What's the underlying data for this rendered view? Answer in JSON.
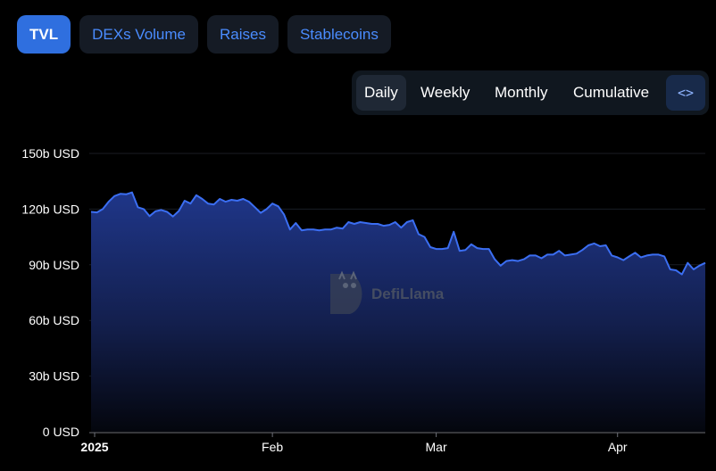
{
  "tabs": [
    "TVL",
    "DEXs Volume",
    "Raises",
    "Stablecoins"
  ],
  "active_tab": "TVL",
  "periods": [
    "Daily",
    "Weekly",
    "Monthly",
    "Cumulative"
  ],
  "active_period": "Daily",
  "embed_icon": "code-icon",
  "watermark": "DefiLlama",
  "colors": {
    "accent": "#2f6fdf",
    "line": "#3b6ef2",
    "fill_top": "#1e3585",
    "background": "#000000"
  },
  "chart_data": {
    "type": "area",
    "title": "",
    "xlabel": "",
    "ylabel": "",
    "ylim": [
      0,
      150
    ],
    "y_ticks": [
      "0 USD",
      "30b USD",
      "60b USD",
      "90b USD",
      "120b USD",
      "150b USD"
    ],
    "y_tick_values": [
      0,
      30,
      60,
      90,
      120,
      150
    ],
    "x_ticks": [
      "2025",
      "Feb",
      "Mar",
      "Apr"
    ],
    "x_tick_days": [
      0,
      31,
      59,
      90
    ],
    "x_unit_note": "",
    "series": [
      {
        "values_day_offset": [
          0,
          1,
          2,
          3,
          4,
          5,
          6,
          7,
          8,
          9,
          10,
          11,
          12,
          13,
          14,
          15,
          16,
          17,
          18,
          19,
          20,
          21,
          22,
          23,
          24,
          25,
          26,
          27,
          28,
          29,
          30,
          31,
          32,
          33,
          34,
          35,
          36,
          37,
          38,
          39,
          40,
          41,
          42,
          43,
          44,
          45,
          46,
          47,
          48,
          49,
          50,
          51,
          52,
          53,
          54,
          55,
          56,
          57,
          58,
          59,
          60,
          61,
          62,
          63,
          64,
          65,
          66,
          67,
          68,
          69,
          70,
          71,
          72,
          73,
          74,
          75,
          76,
          77,
          78,
          79,
          80,
          81,
          82,
          83,
          84,
          85,
          86,
          87,
          88,
          89,
          90,
          91,
          92,
          93,
          94,
          95,
          96,
          97,
          98,
          99,
          100,
          101,
          102,
          103,
          104,
          105
        ],
        "values": [
          118.5,
          118.2,
          120.0,
          124.0,
          127.0,
          128.2,
          128.0,
          129.0,
          121.0,
          120.0,
          116.2,
          118.8,
          119.5,
          118.5,
          116.0,
          119.0,
          124.5,
          123.0,
          127.5,
          125.5,
          123.0,
          122.5,
          125.5,
          124.0,
          125.0,
          124.5,
          125.5,
          124.0,
          121.0,
          118.0,
          120.0,
          123.0,
          121.5,
          117.0,
          109.0,
          112.5,
          108.5,
          109.0,
          109.0,
          108.5,
          109.0,
          109.0,
          110.0,
          109.5,
          113.0,
          112.0,
          113.0,
          112.5,
          112.0,
          112.0,
          111.0,
          111.5,
          113.0,
          110.0,
          113.0,
          114.0,
          106.5,
          105.0,
          99.5,
          98.5,
          98.5,
          99.0,
          107.8,
          97.5,
          98.0,
          101.0,
          99.0,
          98.5,
          98.5,
          93.0,
          89.5,
          92.0,
          92.5,
          92.0,
          93.0,
          95.0,
          95.0,
          93.5,
          95.5,
          95.5,
          97.5,
          95.0,
          95.5,
          96.0,
          98.0,
          100.5,
          101.5,
          100.0,
          100.5,
          95.0,
          94.0,
          92.5,
          94.5,
          96.5,
          94.0,
          95.0,
          95.5,
          95.5,
          94.5,
          87.5,
          87.0,
          84.8,
          91.0,
          87.5,
          89.5,
          91.0
        ]
      }
    ],
    "grid": true,
    "legend": "none"
  }
}
